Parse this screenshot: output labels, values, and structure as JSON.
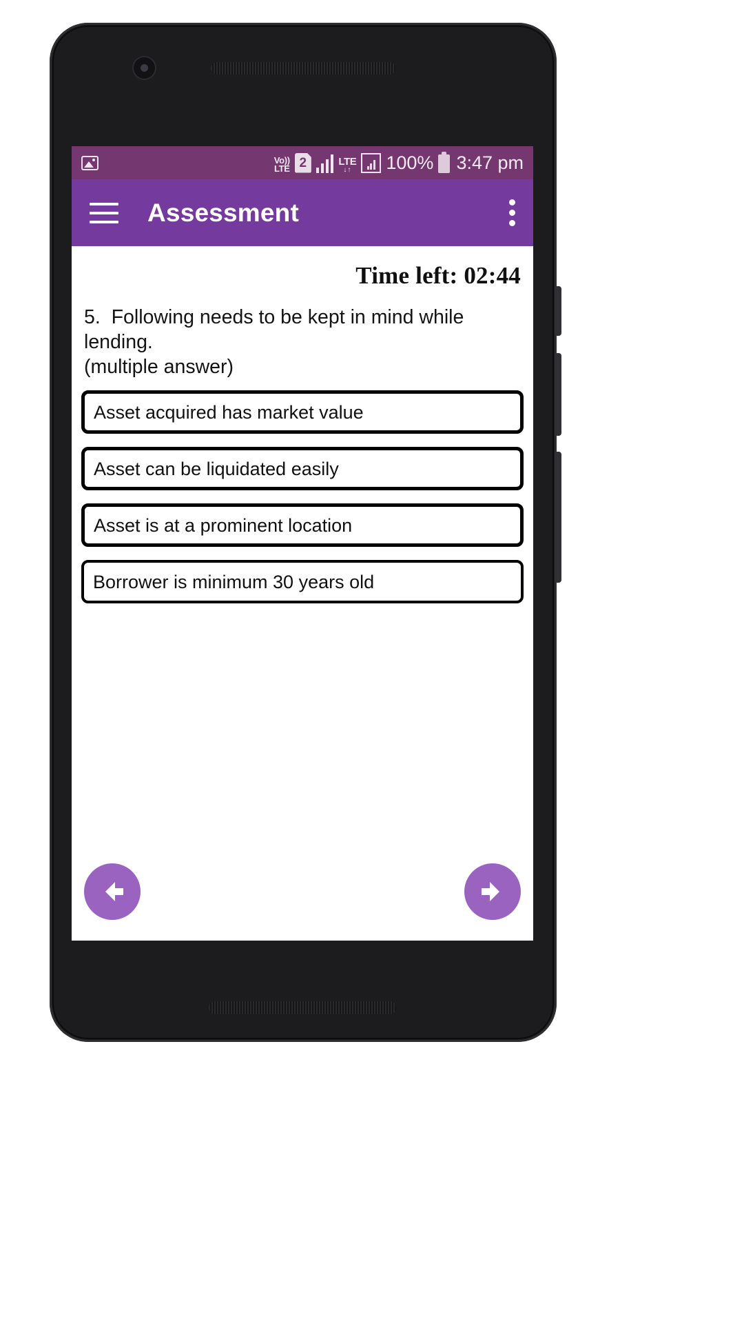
{
  "device": {
    "icons": {
      "camera": "front-camera",
      "earpiece": "earpiece-speaker",
      "home_bar": "home-indicator"
    }
  },
  "status_bar": {
    "left_icons": [
      {
        "name": "photo-icon",
        "label": "image"
      }
    ],
    "volte_line1": "Vo))",
    "volte_line2": "LTE",
    "sim_number": "2",
    "signal_icon": "signal-bars-icon",
    "lte_label": "LTE",
    "lte_arrows": "↓↑",
    "second_signal_icon": "signal-box-icon",
    "battery_percent": "100%",
    "battery_icon": "battery-full-icon",
    "time": "3:47 pm"
  },
  "app_bar": {
    "menu_icon": "hamburger-menu-icon",
    "title": "Assessment",
    "overflow_icon": "overflow-menu-icon"
  },
  "assessment": {
    "timer_label": "Time left: 02:44",
    "question_number": "5.",
    "question_text": "Following needs to be kept in mind while lending.",
    "question_subtext": "(multiple answer)",
    "options": [
      {
        "label": "Asset acquired has market value",
        "selected": false
      },
      {
        "label": "Asset can be liquidated easily",
        "selected": false
      },
      {
        "label": "Asset is at a prominent location",
        "selected": false
      },
      {
        "label": "Borrower is minimum 30 years old",
        "selected": false
      }
    ],
    "prev_button": "previous-question",
    "next_button": "next-question"
  },
  "colors": {
    "status_bar": "#75376f",
    "app_bar": "#753a9d",
    "accent": "#9a63c0",
    "option_border": "#000000",
    "page_bg": "#ffffff",
    "device_body": "#1c1c1e"
  }
}
